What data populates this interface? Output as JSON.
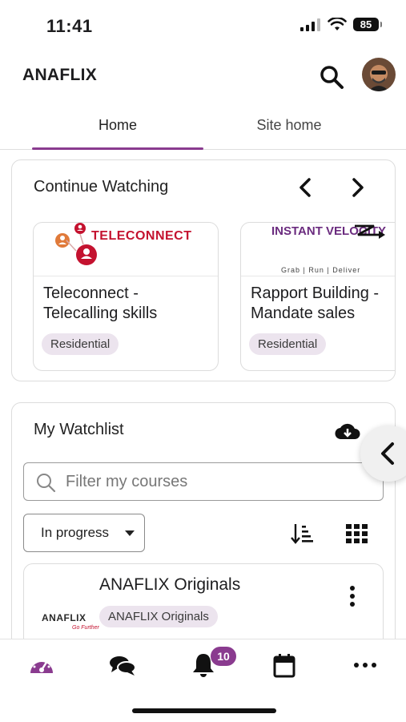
{
  "status": {
    "time": "11:41",
    "battery": "85"
  },
  "header": {
    "title": "ANAFLIX"
  },
  "tabs": [
    {
      "label": "Home"
    },
    {
      "label": "Site home"
    }
  ],
  "continue_watching": {
    "title": "Continue Watching",
    "courses": [
      {
        "logo_text": "TELECONNECT",
        "name": "Teleconnect - Telecalling skills",
        "tag": "Residential"
      },
      {
        "logo_text": "INSTANT VELOCITY",
        "logo_tagline": "Grab | Run | Deliver",
        "name": "Rapport Building - Mandate sales",
        "tag": "Residential"
      }
    ]
  },
  "watchlist": {
    "title": "My Watchlist",
    "filter_placeholder": "Filter my courses",
    "status_filter": "In progress",
    "items": [
      {
        "logo_text": "ANAFLIX",
        "logo_sub": "Go Further",
        "name": "ANAFLIX Originals",
        "tag": "ANAFLIX Originals"
      }
    ]
  },
  "bottom_nav": {
    "notification_count": "10"
  },
  "colors": {
    "accent": "#8a3b8f",
    "pill_bg": "#ece4ee",
    "velocity_purple": "#6b2c7f",
    "teleconnect_red": "#c4122f"
  }
}
